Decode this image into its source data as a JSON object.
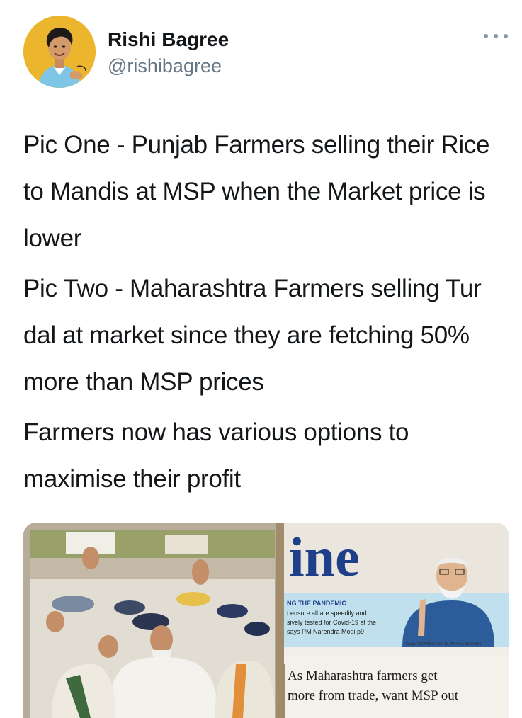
{
  "author": {
    "name": "Rishi Bagree",
    "handle": "@rishibagree",
    "avatar_icon": "user-avatar-illustration"
  },
  "more_icon": "more-horizontal-icon",
  "tweet": {
    "paragraphs": [
      "Pic One - Punjab Farmers selling their Rice to Mandis at MSP when the Market price is lower",
      "Pic Two - Maharashtra Farmers selling Tur dal at market since they are fetching 50% more than MSP prices",
      "Farmers now has various options to maximise their profit"
    ]
  },
  "media": {
    "newspaper": {
      "masthead": "ine",
      "pandemic_heading": "NG THE PANDEMIC",
      "pandemic_lines": [
        "t ensure all are speedily and",
        "sively tested for Covid-19 at the",
        "says PM Narendra Modi p9"
      ],
      "reg_line": "Regd. TN/ARD/14/09-11, RNI No. 55320/54",
      "headline_line1": "As Maharashtra farmers get",
      "headline_line2": "more from trade, want MSP out"
    }
  },
  "colors": {
    "text_primary": "#14171a",
    "text_secondary": "#657786",
    "avatar_bg": "#eab52c",
    "masthead_blue": "#1f3f8a",
    "banner_blue": "#bfe0ec"
  }
}
